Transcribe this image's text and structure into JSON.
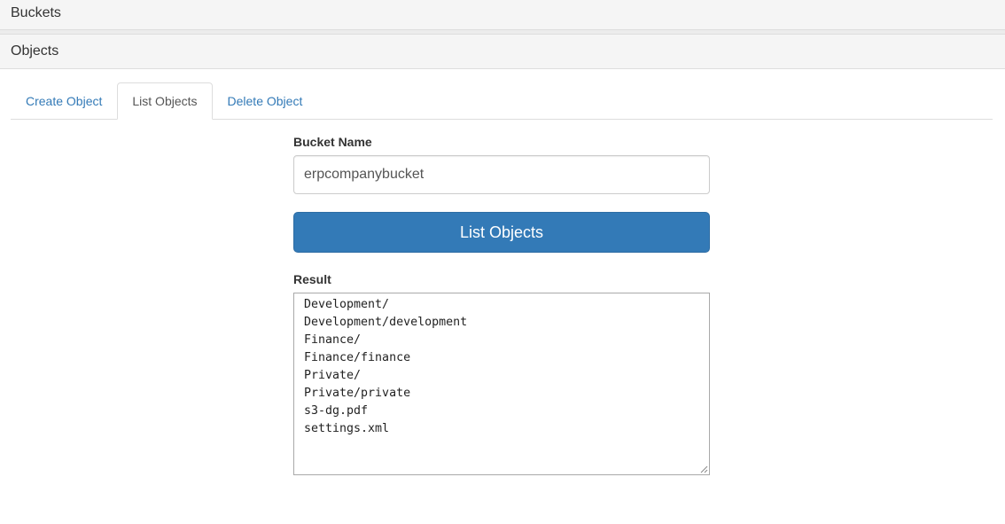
{
  "panels": {
    "buckets_title": "Buckets",
    "objects_title": "Objects"
  },
  "tabs": [
    {
      "label": "Create Object",
      "active": false
    },
    {
      "label": "List Objects",
      "active": true
    },
    {
      "label": "Delete Object",
      "active": false
    }
  ],
  "form": {
    "bucket_label": "Bucket Name",
    "bucket_value": "erpcompanybucket",
    "submit_label": "List Objects",
    "result_label": "Result",
    "result_lines": [
      "Development/",
      "Development/development",
      "Finance/",
      "Finance/finance",
      "Private/",
      "Private/private",
      "s3-dg.pdf",
      "settings.xml"
    ]
  },
  "colors": {
    "link": "#337ab7",
    "primary_button": "#337ab7",
    "panel_heading_bg": "#f5f5f5"
  }
}
